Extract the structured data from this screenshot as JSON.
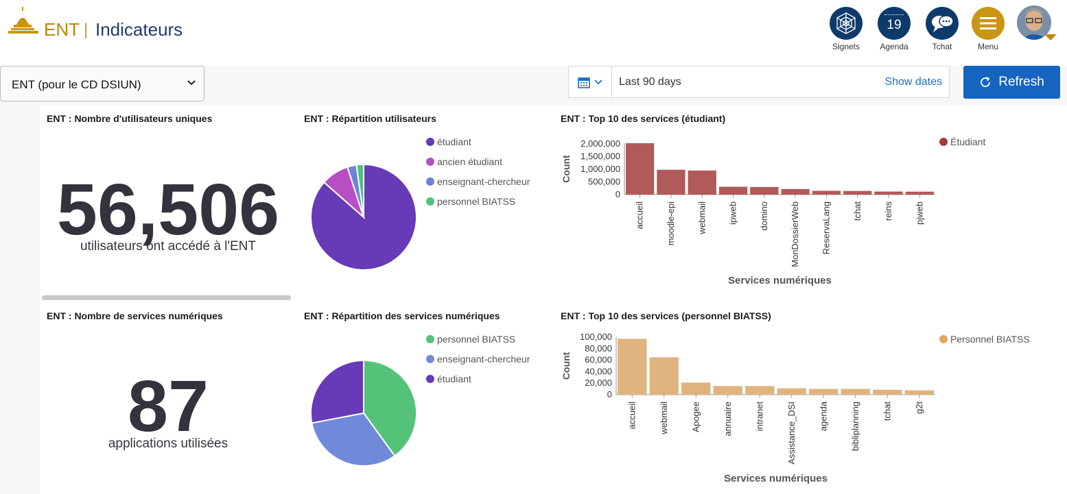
{
  "header": {
    "brand": "ENT",
    "separator": "|",
    "title": "Indicateurs",
    "icons": [
      {
        "label": "Signets",
        "icon": "spiderweb-icon"
      },
      {
        "label": "Agenda",
        "icon": "calendar-icon",
        "badge": "19"
      },
      {
        "label": "Tchat",
        "icon": "chat-icon"
      },
      {
        "label": "Menu",
        "icon": "hamburger-icon"
      }
    ]
  },
  "colors": {
    "navy": "#0d3a6b",
    "gold": "#c99512",
    "accent": "#1565c0",
    "student_bar": "#b05a5a",
    "staff_bar": "#e0b47f"
  },
  "toolbar": {
    "dataset_select": "ENT (pour le CD DSIUN)",
    "date_range": "Last 90 days",
    "show_dates": "Show dates",
    "refresh": "Refresh"
  },
  "panels": {
    "users": {
      "title": "ENT : Nombre d'utilisateurs uniques",
      "value": "56,506",
      "caption": "utilisateurs ont accédé à l'ENT"
    },
    "users_split": {
      "title": "ENT : Répartition utilisateurs"
    },
    "top_students": {
      "title": "ENT : Top 10 des services (étudiant)"
    },
    "services": {
      "title": "ENT : Nombre de services numériques",
      "value": "87",
      "caption": "applications utilisées"
    },
    "services_split": {
      "title": "ENT : Répartition des services numériques"
    },
    "top_staff": {
      "title": "ENT : Top 10 des services (personnel BIATSS)"
    }
  },
  "chart_data": [
    {
      "id": "users_split",
      "type": "pie",
      "labels": [
        "étudiant",
        "ancien étudiant",
        "enseignant-chercheur",
        "personnel BIATSS"
      ],
      "values": [
        86.5,
        8.5,
        2.8,
        2.2
      ],
      "colors": [
        "#673ab7",
        "#b74fc4",
        "#6f83d9",
        "#4fc27c"
      ],
      "legend": "right"
    },
    {
      "id": "top_students",
      "type": "bar",
      "categories": [
        "accueil",
        "moodle-epi",
        "webmail",
        "ipweb",
        "domino",
        "MonDossierWeb",
        "ReservaLang",
        "tchat",
        "reins",
        "pjweb"
      ],
      "series": [
        {
          "name": "Étudiant",
          "values": [
            2030000,
            980000,
            950000,
            310000,
            300000,
            220000,
            150000,
            145000,
            120000,
            115000
          ],
          "color": "#b05a5a"
        }
      ],
      "xlabel": "Services numériques",
      "ylabel": "Count",
      "yticks": [
        "2,000,000",
        "1,500,000",
        "1,000,000",
        "500,000",
        "0"
      ],
      "yticks_v": [
        2000000,
        1500000,
        1000000,
        500000,
        0
      ],
      "ylim": [
        0,
        2030000
      ],
      "legend": "top-right"
    },
    {
      "id": "services_split",
      "type": "pie",
      "labels": [
        "personnel BIATSS",
        "enseignant-chercheur",
        "étudiant"
      ],
      "values": [
        40,
        32,
        28
      ],
      "colors": [
        "#55c27a",
        "#6f8ad9",
        "#673ab7"
      ],
      "legend": "right"
    },
    {
      "id": "top_staff",
      "type": "bar",
      "categories": [
        "accueil",
        "webmail",
        "Apogee",
        "annuaire",
        "intranet",
        "Assistance_DSI",
        "agenda",
        "bibliplanning",
        "tchat",
        "g2t"
      ],
      "series": [
        {
          "name": "Personnel BIATSS",
          "values": [
            97000,
            65000,
            21000,
            15000,
            15000,
            11000,
            10000,
            10000,
            8500,
            7500
          ],
          "color": "#e0b47f"
        }
      ],
      "xlabel": "Services numériques",
      "ylabel": "Count",
      "yticks": [
        "100,000",
        "80,000",
        "60,000",
        "40,000",
        "20,000",
        "0"
      ],
      "yticks_v": [
        100000,
        80000,
        60000,
        40000,
        20000,
        0
      ],
      "ylim": [
        0,
        100000
      ],
      "legend": "top-right"
    }
  ]
}
